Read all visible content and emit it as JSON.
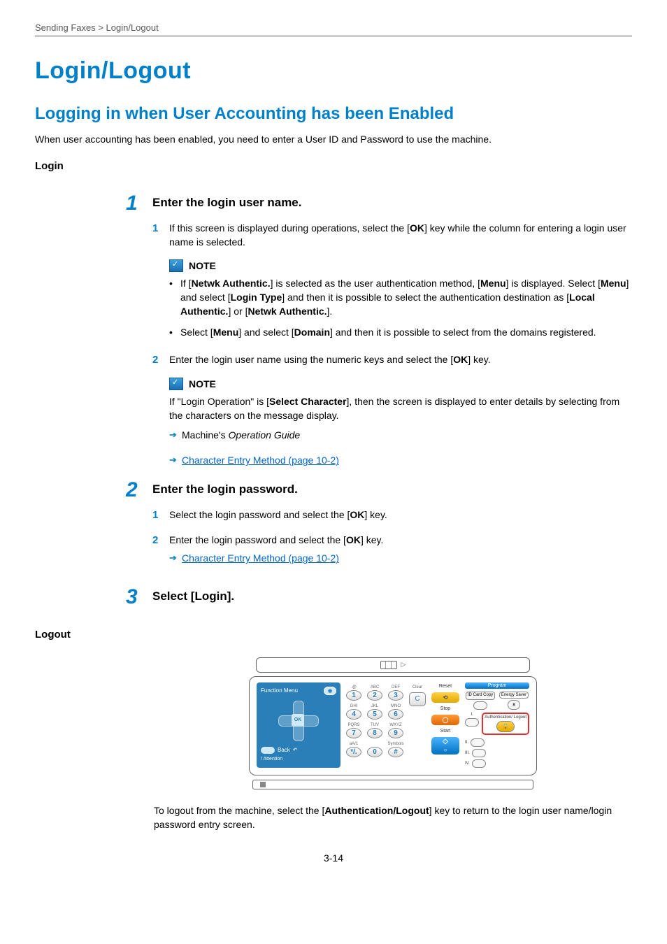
{
  "breadcrumb": "Sending Faxes > Login/Logout",
  "h1": "Login/Logout",
  "h2": "Logging in when User Accounting has been Enabled",
  "intro": "When user accounting has been enabled, you need to enter a User ID and Password to use the machine.",
  "login_heading": "Login",
  "steps": {
    "s1": {
      "num": "1",
      "title": "Enter the login user name.",
      "sub1_num": "1",
      "sub1_a": "If this screen is displayed during operations, select the [",
      "sub1_b": "OK",
      "sub1_c": "] key while the column for entering a login user name is selected.",
      "note1_label": "NOTE",
      "note1_b1_a": "If [",
      "note1_b1_b": "Netwk Authentic.",
      "note1_b1_c": "] is selected as the user authentication method, [",
      "note1_b1_d": "Menu",
      "note1_b1_e": "] is displayed. Select [",
      "note1_b1_f": "Menu",
      "note1_b1_g": "] and select [",
      "note1_b1_h": "Login Type",
      "note1_b1_i": "] and then it is possible to select the authentication destination as [",
      "note1_b1_j": "Local Authentic.",
      "note1_b1_k": "] or [",
      "note1_b1_l": "Netwk Authentic.",
      "note1_b1_m": "].",
      "note1_b2_a": "Select [",
      "note1_b2_b": "Menu",
      "note1_b2_c": "] and select [",
      "note1_b2_d": "Domain",
      "note1_b2_e": "] and then it is possible to select from the domains registered.",
      "sub2_num": "2",
      "sub2_a": "Enter the login user name using the numeric keys and select the [",
      "sub2_b": "OK",
      "sub2_c": "] key.",
      "note2_label": "NOTE",
      "note2_a": "If \"Login Operation\" is [",
      "note2_b": "Select Character",
      "note2_c": "], then the screen is displayed to enter details by selecting from the characters on the message display.",
      "ref1_a": "Machine's ",
      "ref1_b": "Operation Guide",
      "ref2": "Character Entry Method (page 10-2)"
    },
    "s2": {
      "num": "2",
      "title": "Enter the login password.",
      "sub1_num": "1",
      "sub1_a": "Select the login password and select the [",
      "sub1_b": "OK",
      "sub1_c": "] key.",
      "sub2_num": "2",
      "sub2_a": "Enter the login password and select the [",
      "sub2_b": "OK",
      "sub2_c": "] key.",
      "ref": "Character Entry Method (page 10-2)"
    },
    "s3": {
      "num": "3",
      "title": "Select [Login]."
    }
  },
  "logout_heading": "Logout",
  "panel": {
    "fn_menu": "Function Menu",
    "ok": "OK",
    "back": "Back",
    "attention": "! Attention",
    "keys": {
      "r1": [
        ".@",
        "ABC",
        "DEF"
      ],
      "r2": [
        "GHI",
        "JKL",
        "MNO"
      ],
      "r3": [
        "PQRS",
        "TUV",
        "WXYZ"
      ],
      "r4": [
        "aA/1",
        "",
        "Symbols"
      ],
      "nums": [
        "1",
        "2",
        "3",
        "4",
        "5",
        "6",
        "7",
        "8",
        "9",
        "*/.",
        "0",
        "#"
      ]
    },
    "clear": "Clear",
    "reset": "Reset",
    "stop": "Stop",
    "start": "Start",
    "program": "Program",
    "idcard": "ID Card Copy",
    "energy": "Energy Saver",
    "auth": "Authentication/\nLogout",
    "slots": [
      "I.",
      "II.",
      "III.",
      "IV."
    ]
  },
  "logout_text_a": "To logout from the machine, select the [",
  "logout_text_b": "Authentication/Logout",
  "logout_text_c": "] key to return to the login user name/login password entry screen.",
  "page_num": "3-14"
}
